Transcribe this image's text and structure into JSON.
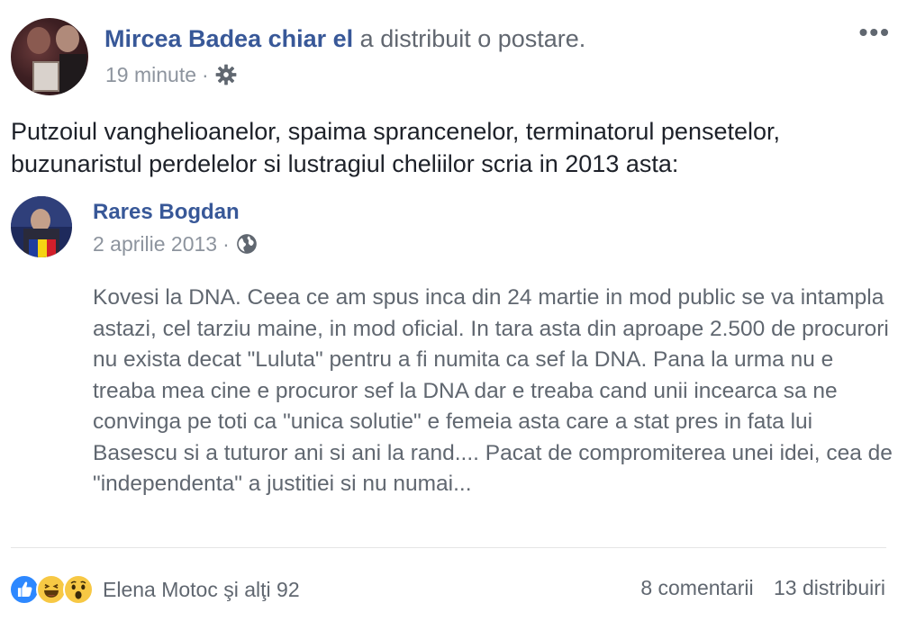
{
  "header": {
    "author": "Mircea Badea chiar el",
    "action": "a distribuit o postare.",
    "time": "19 minute",
    "separator": "·",
    "privacy_icon": "gear-icon",
    "more_label": "•••"
  },
  "post": {
    "text": "Putzoiul vanghelioanelor, spaima sprancenelor, terminatorul pensetelor, buzunaristul perdelelor si lustragiul cheliilor scria in 2013 asta:"
  },
  "shared": {
    "author": "Rares Bogdan",
    "date": "2 aprilie 2013",
    "separator": "·",
    "privacy_icon": "globe-icon",
    "text": "Kovesi la DNA. Ceea ce am spus inca din 24 martie in mod public se va intampla astazi, cel tarziu maine, in mod oficial. In tara asta din aproape 2.500 de procurori nu exista decat \"Luluta\" pentru a fi numita ca sef la DNA. Pana la urma nu e treaba mea cine e procuror sef la DNA dar e treaba cand unii incearca sa ne convinga pe toti ca \"unica solutie\" e femeia asta care a stat pres in fata lui Basescu si a tuturor ani si ani la rand.... Pacat de compromiterea unei idei, cea de \"independenta\" a justitiei si nu numai..."
  },
  "footer": {
    "reactions": [
      "like-icon",
      "haha-icon",
      "wow-icon"
    ],
    "reactions_text": "Elena Motoc şi alţi 92",
    "comments": "8 comentarii",
    "shares": "13 distribuiri"
  },
  "colors": {
    "name_blue": "#385898",
    "meta_gray": "#8d949e",
    "like_blue": "#2d88ff",
    "emoji_yellow": "#f7c844"
  }
}
